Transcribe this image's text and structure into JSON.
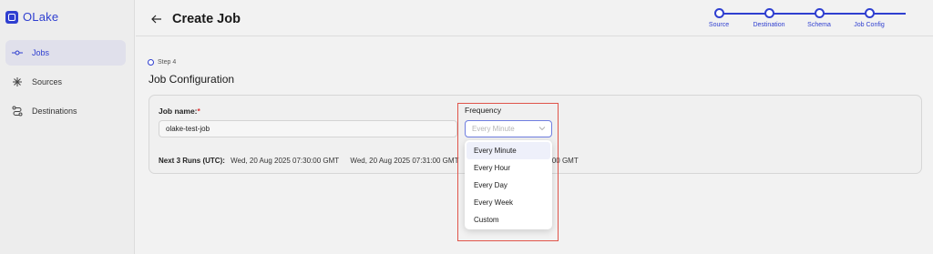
{
  "app": {
    "name": "OLake",
    "accent_color": "#2f3fd0"
  },
  "sidebar": {
    "items": [
      {
        "label": "Jobs",
        "icon": "git-commit-icon",
        "active": true
      },
      {
        "label": "Sources",
        "icon": "sources-icon",
        "active": false
      },
      {
        "label": "Destinations",
        "icon": "route-icon",
        "active": false
      }
    ]
  },
  "header": {
    "title": "Create Job",
    "steps": [
      {
        "label": "Source"
      },
      {
        "label": "Destination"
      },
      {
        "label": "Schema"
      },
      {
        "label": "Job Config"
      }
    ]
  },
  "main": {
    "step_indicator": "Step 4",
    "section_title": "Job Configuration",
    "job_name_label": "Job name:",
    "job_name_required": "*",
    "job_name_value": "olake-test-job",
    "next_runs_label": "Next 3 Runs (UTC):",
    "next_runs": [
      "Wed, 20 Aug 2025 07:30:00 GMT",
      "Wed, 20 Aug 2025 07:31:00 GMT",
      "Wed, 20 Aug 2025 07:32:00 GMT"
    ]
  },
  "frequency": {
    "label": "Frequency",
    "placeholder": "Every Minute",
    "options": [
      "Every Minute",
      "Every Hour",
      "Every Day",
      "Every Week",
      "Custom"
    ],
    "selected_index": 0,
    "highlight_color": "#e0544a"
  }
}
